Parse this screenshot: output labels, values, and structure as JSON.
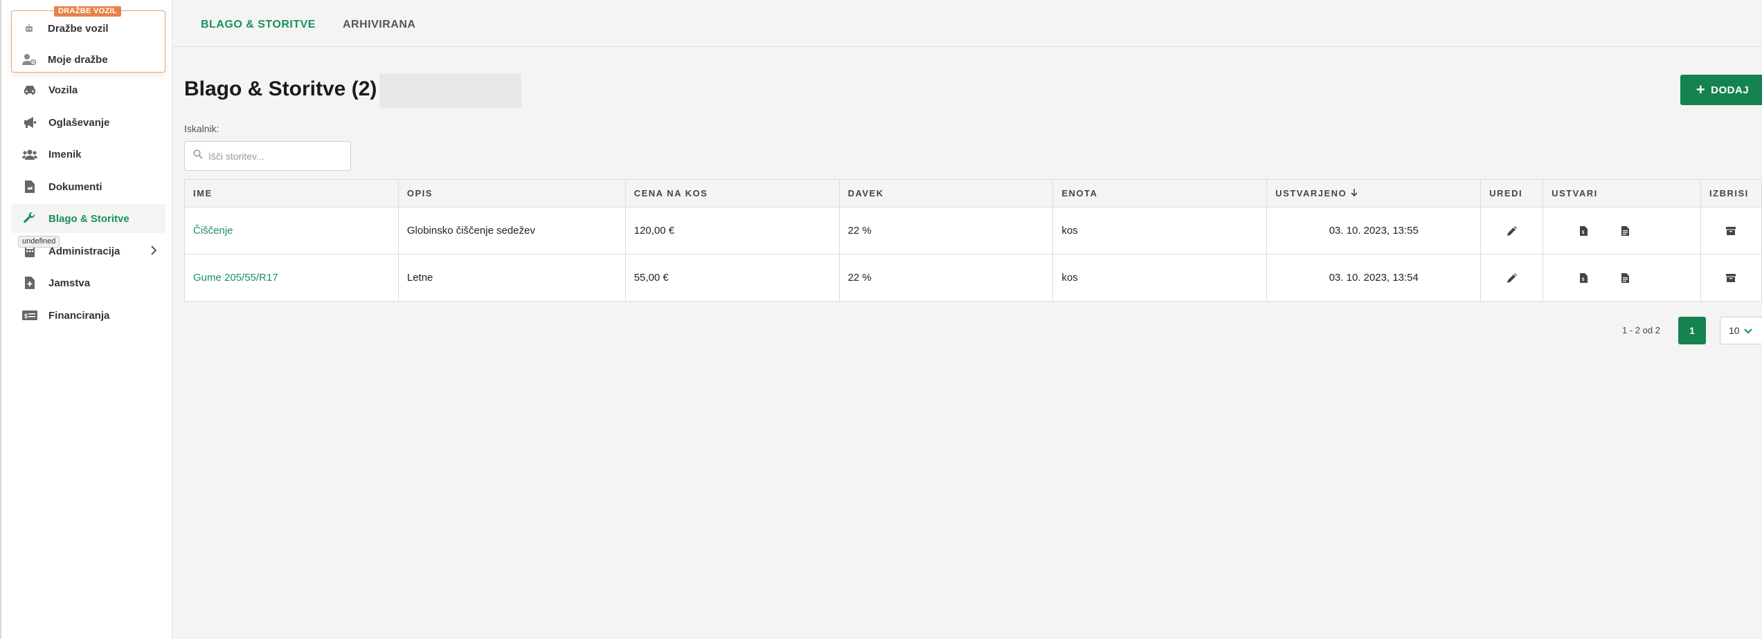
{
  "sidebar": {
    "promo": {
      "tag": "DRAŽBE VOZIL",
      "items": [
        {
          "label": "Dražbe vozil",
          "icon": "robot-icon"
        },
        {
          "label": "Moje dražbe",
          "icon": "user-gear-icon"
        }
      ]
    },
    "items": [
      {
        "label": "Vozila",
        "icon": "car-icon"
      },
      {
        "label": "Oglaševanje",
        "icon": "megaphone-icon"
      },
      {
        "label": "Imenik",
        "icon": "users-icon"
      },
      {
        "label": "Dokumenti",
        "icon": "document-icon"
      },
      {
        "label": "Blago & Storitve",
        "icon": "wrench-icon",
        "active": true
      },
      {
        "label": "Administracija",
        "icon": "calculator-icon"
      },
      {
        "label": "Jamstva",
        "icon": "file-plus-icon"
      },
      {
        "label": "Financiranja",
        "icon": "money-card-icon"
      }
    ],
    "tooltip": "undefined"
  },
  "tabs": [
    {
      "label": "BLAGO & STORITVE",
      "active": true
    },
    {
      "label": "ARHIVIRANA",
      "active": false
    }
  ],
  "main": {
    "title": "Blago & Storitve (2)",
    "add_label": "DODAJ",
    "search_label": "Iskalnik:",
    "search_placeholder": "Išči storitev..."
  },
  "table": {
    "headers": [
      "IME",
      "OPIS",
      "CENA NA KOS",
      "DAVEK",
      "ENOTA",
      "USTVARJENO",
      "UREDI",
      "USTVARI",
      "IZBRISI"
    ],
    "rows": [
      {
        "ime": "Čiščenje",
        "opis": "Globinsko čiščenje sedežev",
        "cena": "120,00 €",
        "davek": "22 %",
        "enota": "kos",
        "ustvarjeno": "03. 10. 2023, 13:55"
      },
      {
        "ime": "Gume 205/55/R17",
        "opis": "Letne",
        "cena": "55,00 €",
        "davek": "22 %",
        "enota": "kos",
        "ustvarjeno": "03. 10. 2023, 13:54"
      }
    ]
  },
  "pagination": {
    "summary": "1 - 2  od  2",
    "current_page": "1",
    "page_size": "10"
  },
  "colors": {
    "accent": "#18925a",
    "button": "#15834f",
    "promo_tag": "#e9834a"
  }
}
